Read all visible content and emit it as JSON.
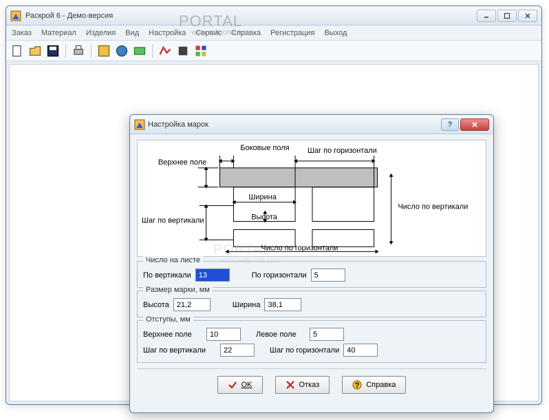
{
  "window": {
    "title": "Раскрой 6 - Демо-версия"
  },
  "menu": {
    "items": [
      "Заказ",
      "Материал",
      "Изделия",
      "Вид",
      "Настройка",
      "Сервис",
      "Справка",
      "Регистрация",
      "Выход"
    ]
  },
  "toolbar_icons": [
    "new",
    "open",
    "save",
    "print",
    "tool1",
    "tool2",
    "tool3",
    "tool4",
    "tool5",
    "tool6",
    "tool7"
  ],
  "dialog": {
    "title": "Настройка марок",
    "diagram": {
      "label_side_margins": "Боковые поля",
      "label_top_margin": "Верхнее поле",
      "label_step_h": "Шаг по горизонтали",
      "label_step_v": "Шаг по вертикали",
      "label_width": "Ширина",
      "label_height": "Высота",
      "label_count_v": "Число по вертикали",
      "label_count_h": "Число по горизонтали"
    },
    "count": {
      "group_title": "Число на листе",
      "label_v": "По вертикали",
      "value_v": "13",
      "label_h": "По горизонтали",
      "value_h": "5"
    },
    "size": {
      "group_title": "Размер марки, мм",
      "label_height": "Высота",
      "value_height": "21,2",
      "label_width": "Ширина",
      "value_width": "38,1"
    },
    "margins": {
      "group_title": "Отступы, мм",
      "label_top": "Верхнее поле",
      "value_top": "10",
      "label_left": "Левое поле",
      "value_left": "5",
      "label_step_v": "Шаг по вертикали",
      "value_step_v": "22",
      "label_step_h": "Шаг по горизонтали",
      "value_step_h": "40"
    },
    "buttons": {
      "ok": "OK",
      "cancel": "Отказ",
      "help": "Справка"
    }
  },
  "watermark": {
    "brand": "PORTAL",
    "url": "www.softportal.com"
  }
}
